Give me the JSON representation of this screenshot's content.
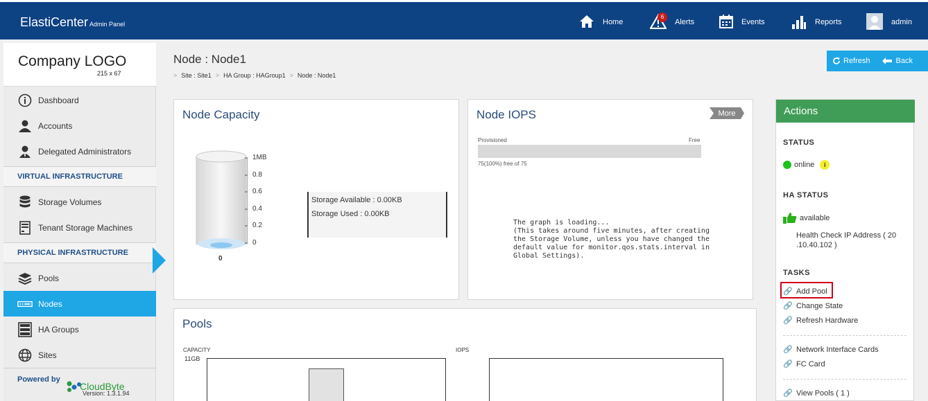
{
  "header": {
    "app_name": "ElastiCenter",
    "app_suffix": "Admin Panel",
    "nav": {
      "home": "Home",
      "alerts": "Alerts",
      "alerts_count": "6",
      "events": "Events",
      "reports": "Reports",
      "user": "admin"
    }
  },
  "sidebar": {
    "logo_text": "Company LOGO",
    "logo_size": "215 x 67",
    "items": {
      "dashboard": "Dashboard",
      "accounts": "Accounts",
      "delegated_admins": "Delegated Administrators",
      "virtual_heading": "VIRTUAL INFRASTRUCTURE",
      "storage_volumes": "Storage Volumes",
      "tenant_storage": "Tenant Storage Machines",
      "physical_heading": "PHYSICAL INFRASTRUCTURE",
      "pools": "Pools",
      "nodes": "Nodes",
      "ha_groups": "HA Groups",
      "sites": "Sites"
    },
    "powered_by": "Powered by",
    "vendor": "CloudByte",
    "version": "Version: 1.3.1.94"
  },
  "page": {
    "title": "Node : Node1",
    "breadcrumb": [
      "Site : Site1",
      "HA Group : HAGroup1",
      "Node : Node1"
    ],
    "refresh_label": "Refresh",
    "back_label": "Back"
  },
  "capacity": {
    "title": "Node Capacity",
    "ticks": [
      "1MB",
      "0.8",
      "0.6",
      "0.4",
      "0.2",
      "0"
    ],
    "cylinder_value": "0",
    "available": "Storage Available : 0.00KB",
    "used": "Storage Used : 0.00KB"
  },
  "iops": {
    "title": "Node IOPS",
    "more_label": "More",
    "provisioned_label": "Provisioned",
    "free_label": "Free",
    "free_summary": "75(100%) free of 75",
    "loading_lines": [
      "The graph is loading...",
      "(This takes around five minutes, after creating",
      "the Storage Volume, unless you have changed the",
      "default value for monitor.qos.stats.interval in",
      "Global Settings)."
    ]
  },
  "pools": {
    "title": "Pools",
    "capacity_label": "CAPACITY",
    "capacity_value": "11GB",
    "iops_label": "IOPS"
  },
  "actions": {
    "title": "Actions",
    "status_heading": "STATUS",
    "status_value": "online",
    "ha_status_heading": "HA STATUS",
    "ha_status_value": "available",
    "health_check_line1": "Health Check IP Address ( 20",
    "health_check_line2": ".10.40.102 )",
    "tasks_heading": "TASKS",
    "tasks": [
      "Add Pool",
      "Change State",
      "Refresh Hardware"
    ],
    "hardware": [
      "Network Interface Cards",
      "FC Card"
    ],
    "views": [
      "View Pools ( 1 )"
    ]
  },
  "colors": {
    "header_bg": "#0d4283",
    "accent_blue": "#1ea6e5",
    "actions_green": "#3f9d57",
    "highlight_red": "#d0021b"
  }
}
